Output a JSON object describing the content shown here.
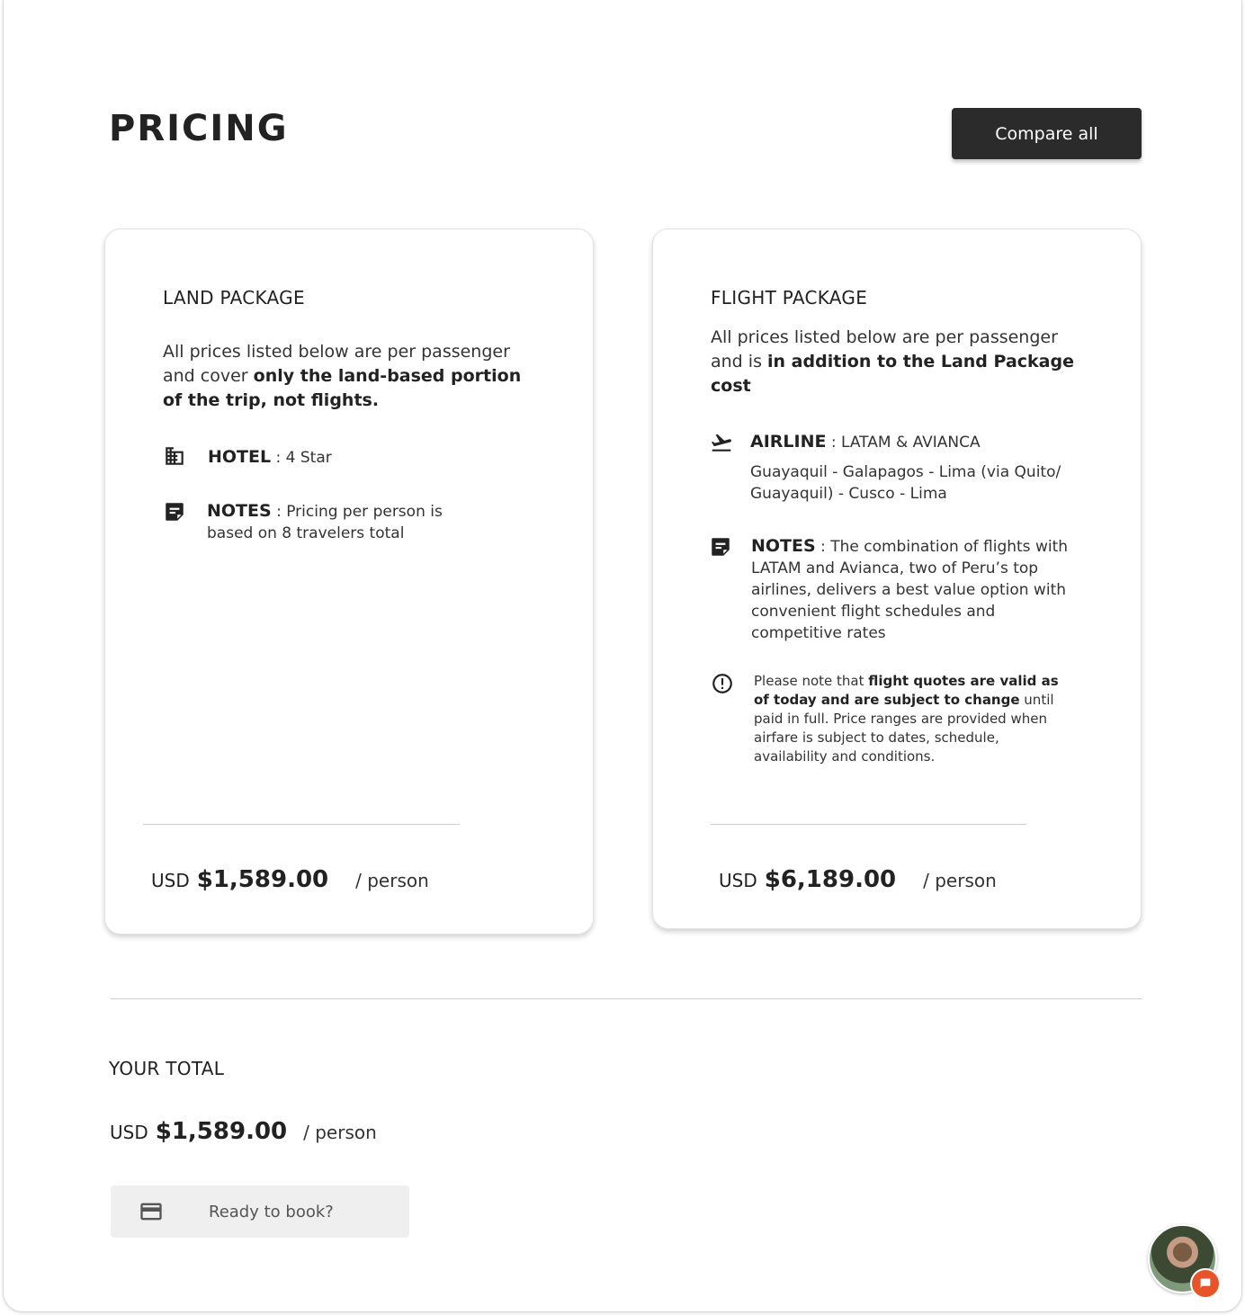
{
  "page": {
    "title": "PRICING",
    "compare_label": "Compare all"
  },
  "land": {
    "title": "LAND PACKAGE",
    "desc_prefix": "All prices listed below are per passenger and cover ",
    "desc_bold": "only the land-based portion of the trip, not flights.",
    "hotel_label": "HOTEL",
    "hotel_value": " : 4 Star",
    "notes_label": "NOTES",
    "notes_value": " : Pricing per person is based on 8 travelers total",
    "currency": "USD",
    "price": "$1,589.00",
    "per": "/ person"
  },
  "flight": {
    "title": "FLIGHT PACKAGE",
    "desc_prefix": "All prices listed below are per passenger and is ",
    "desc_bold": "in addition to the Land Package cost",
    "airline_label": "AIRLINE",
    "airline_value": " : LATAM & AVIANCA",
    "route": "Guayaquil - Galapagos - Lima (via Quito/ Guayaquil) - Cusco - Lima",
    "notes_label": "NOTES",
    "notes_value": " : The combination of flights with LATAM and Avianca, two of Peru’s top airlines, delivers a best value option with convenient flight schedules and competitive rates",
    "warn_prefix": "Please note that ",
    "warn_bold": "flight quotes are valid as of today and are subject to change",
    "warn_suffix": " until paid in full. Price ranges are provided when airfare is subject to dates, schedule, availability and conditions.",
    "currency": "USD",
    "price": "$6,189.00",
    "per": "/ person"
  },
  "total": {
    "label": "YOUR TOTAL",
    "currency": "USD",
    "price": "$1,589.00",
    "per": "/ person",
    "book_label": "Ready to book?"
  },
  "icons": {
    "hotel": "hotel-building-icon",
    "notes": "sticky-note-icon",
    "airline": "flight-takeoff-icon",
    "warning": "info-alert-icon",
    "card": "credit-card-icon",
    "chat": "chat-bubble-icon"
  },
  "colors": {
    "button_dark": "#2b2b2b",
    "chat_badge": "#e8542a"
  }
}
